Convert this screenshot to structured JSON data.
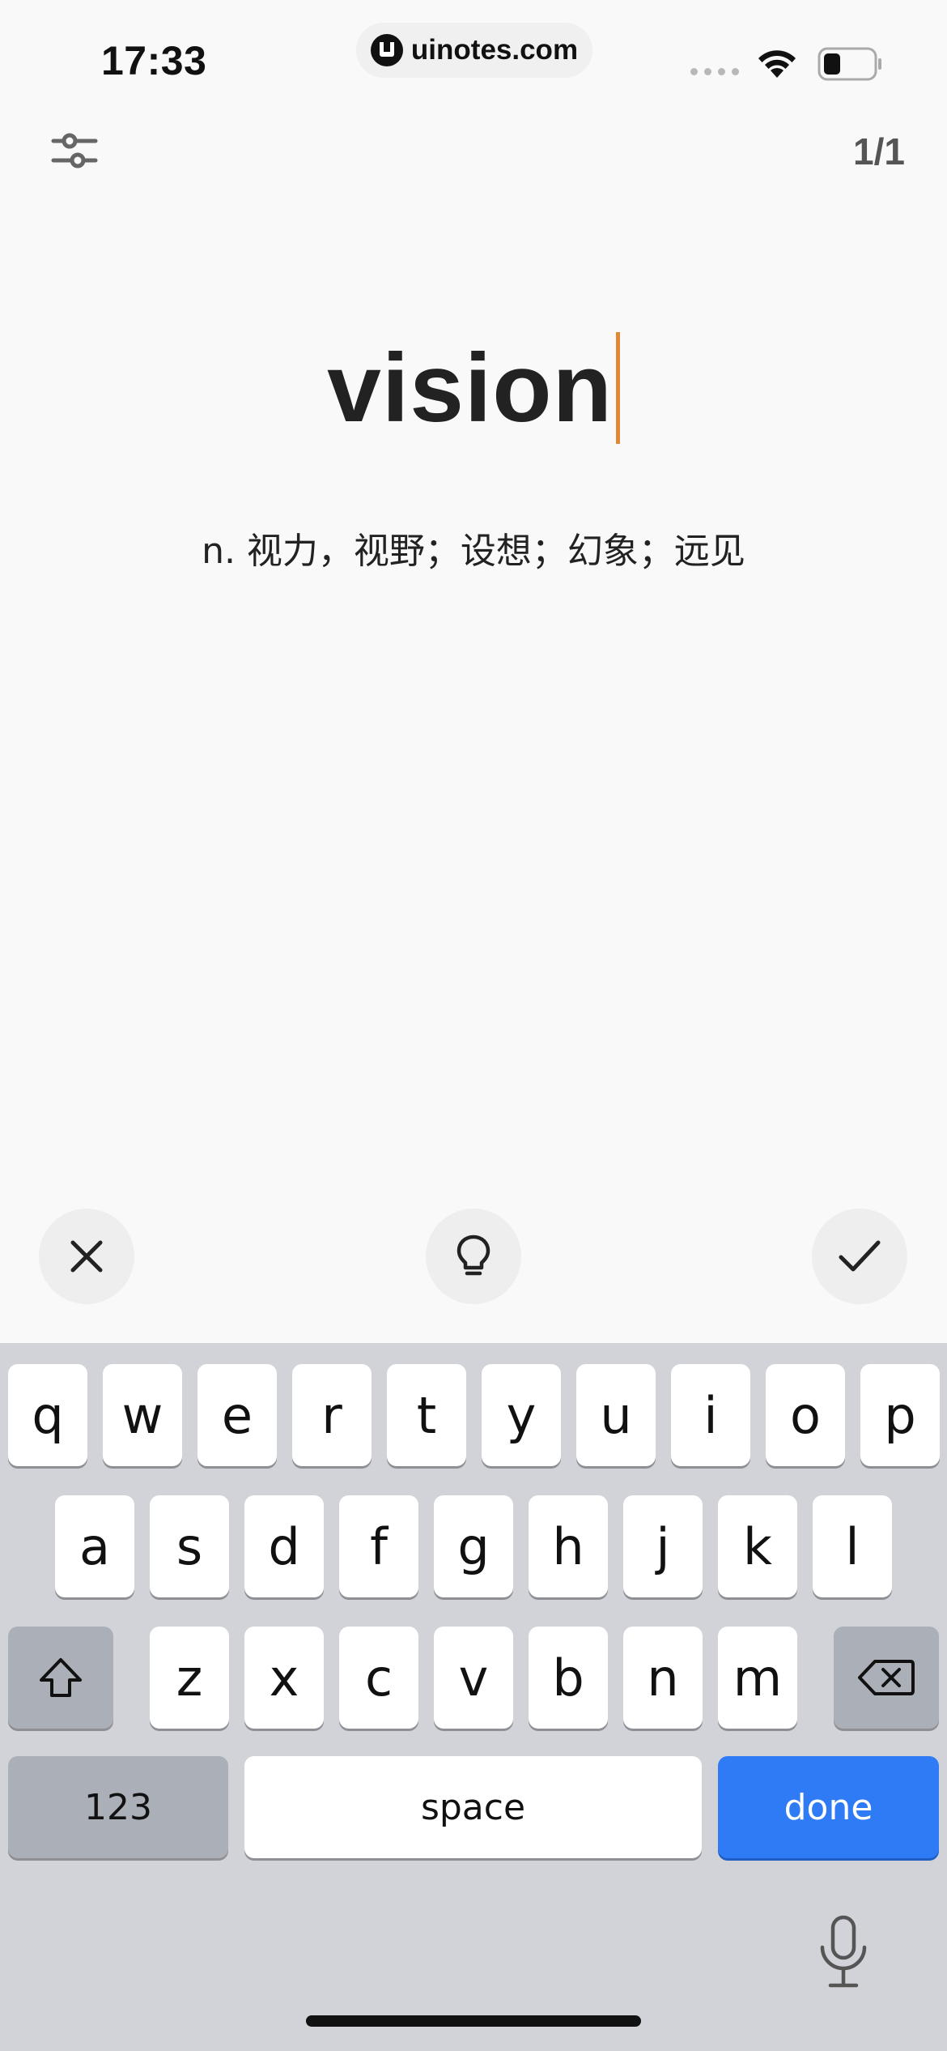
{
  "status_bar": {
    "time": "17:33",
    "url": "uinotes.com",
    "logo_letter": "U"
  },
  "header": {
    "counter": "1/1",
    "settings_icon": "sliders-icon"
  },
  "card": {
    "word": "vision",
    "definition": "n. 视力，视野；设想；幻象；远见"
  },
  "actions": {
    "wrong_icon": "close-icon",
    "hint_icon": "lightbulb-icon",
    "correct_icon": "checkmark-icon"
  },
  "keyboard": {
    "row1": [
      "q",
      "w",
      "e",
      "r",
      "t",
      "y",
      "u",
      "i",
      "o",
      "p"
    ],
    "row2": [
      "a",
      "s",
      "d",
      "f",
      "g",
      "h",
      "j",
      "k",
      "l"
    ],
    "row3": [
      "z",
      "x",
      "c",
      "v",
      "b",
      "n",
      "m"
    ],
    "numbers_label": "123",
    "space_label": "space",
    "done_label": "done"
  },
  "colors": {
    "accent_caret": "#e08838",
    "done_key": "#2f7bf5"
  }
}
